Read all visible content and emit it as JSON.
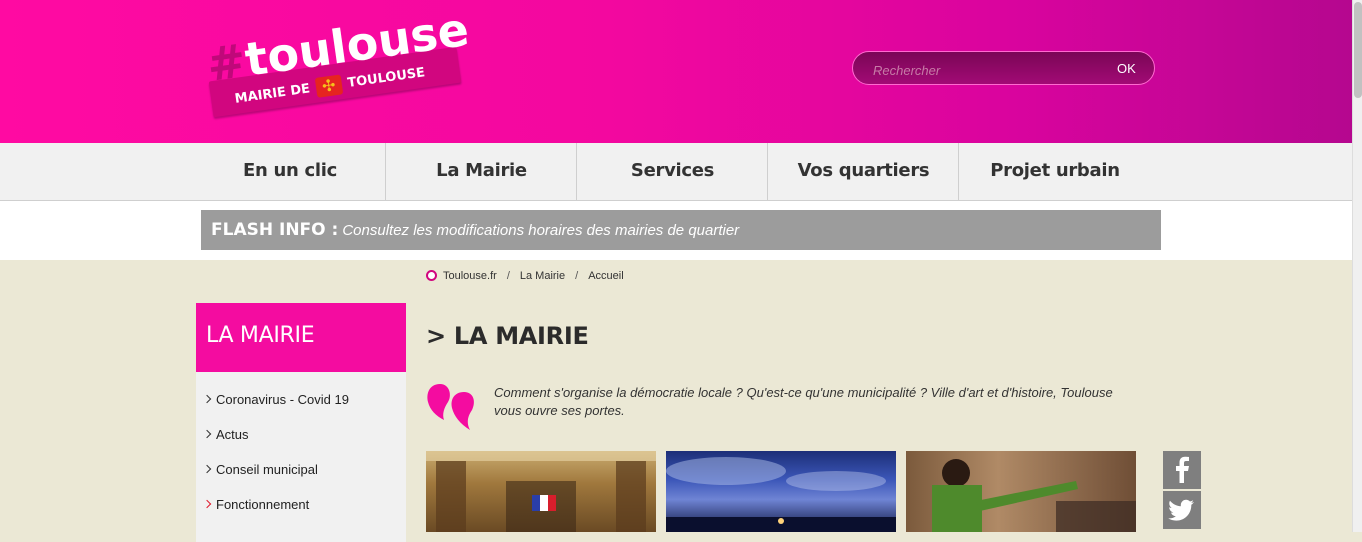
{
  "header": {
    "logo_word": "toulouse",
    "logo_hash": "#",
    "logo_sub_left": "MAIRIE DE",
    "logo_sub_right": "TOULOUSE",
    "search_placeholder": "Rechercher",
    "search_button": "OK"
  },
  "nav": {
    "items": [
      {
        "label": "En un clic"
      },
      {
        "label": "La Mairie"
      },
      {
        "label": "Services"
      },
      {
        "label": "Vos quartiers"
      },
      {
        "label": "Projet urbain"
      }
    ]
  },
  "flash": {
    "label": "FLASH INFO :",
    "text": "Consultez les modifications horaires des mairies de quartier"
  },
  "breadcrumb": {
    "items": [
      {
        "label": "Toulouse.fr"
      },
      {
        "label": "La Mairie"
      },
      {
        "label": "Accueil"
      }
    ],
    "separator": "/"
  },
  "sidebar": {
    "title": "LA MAIRIE",
    "items": [
      {
        "label": "Coronavirus - Covid 19"
      },
      {
        "label": "Actus"
      },
      {
        "label": "Conseil municipal"
      },
      {
        "label": "Fonctionnement"
      }
    ]
  },
  "main": {
    "title": "> LA MAIRIE",
    "intro": "Comment s'organise la démocratie locale ? Qu'est-ce qu'une municipalité ? Ville d'art et d'histoire, Toulouse vous ouvre ses portes.",
    "intro_icon": "pink-quote-icon",
    "thumbnails": [
      {
        "icon": "capitole-hall-photo"
      },
      {
        "icon": "night-sky-city-photo"
      },
      {
        "icon": "council-meeting-photo"
      }
    ]
  },
  "social": [
    {
      "icon": "facebook-icon"
    },
    {
      "icon": "twitter-icon"
    }
  ],
  "colors": {
    "brand_pink": "#f40ca0",
    "header_end": "#b5078f",
    "flash_bg": "#9c9c9c",
    "page_bg": "#ebe8d5"
  }
}
